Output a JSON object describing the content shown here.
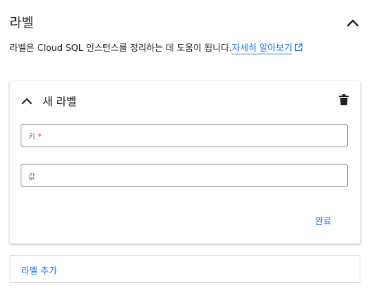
{
  "section": {
    "title": "라벨",
    "description": "라벨은 Cloud SQL 인스턴스를 정리하는 데 도움이 됩니다.",
    "learn_more": "자세히 알아보기",
    "toggle_icon": "chevron-up-icon",
    "link_icon": "external-link-icon"
  },
  "label_card": {
    "title": "새 라벨",
    "collapse_icon": "chevron-up-icon",
    "delete_icon": "trash-icon",
    "key_field": {
      "label": "키",
      "required": "*",
      "value": ""
    },
    "value_field": {
      "label": "값",
      "value": ""
    },
    "done_label": "완료"
  },
  "add_label": "라벨 추가",
  "colors": {
    "accent": "#1a73e8",
    "required": "#d93025",
    "text": "#202124",
    "border": "#80868b"
  }
}
